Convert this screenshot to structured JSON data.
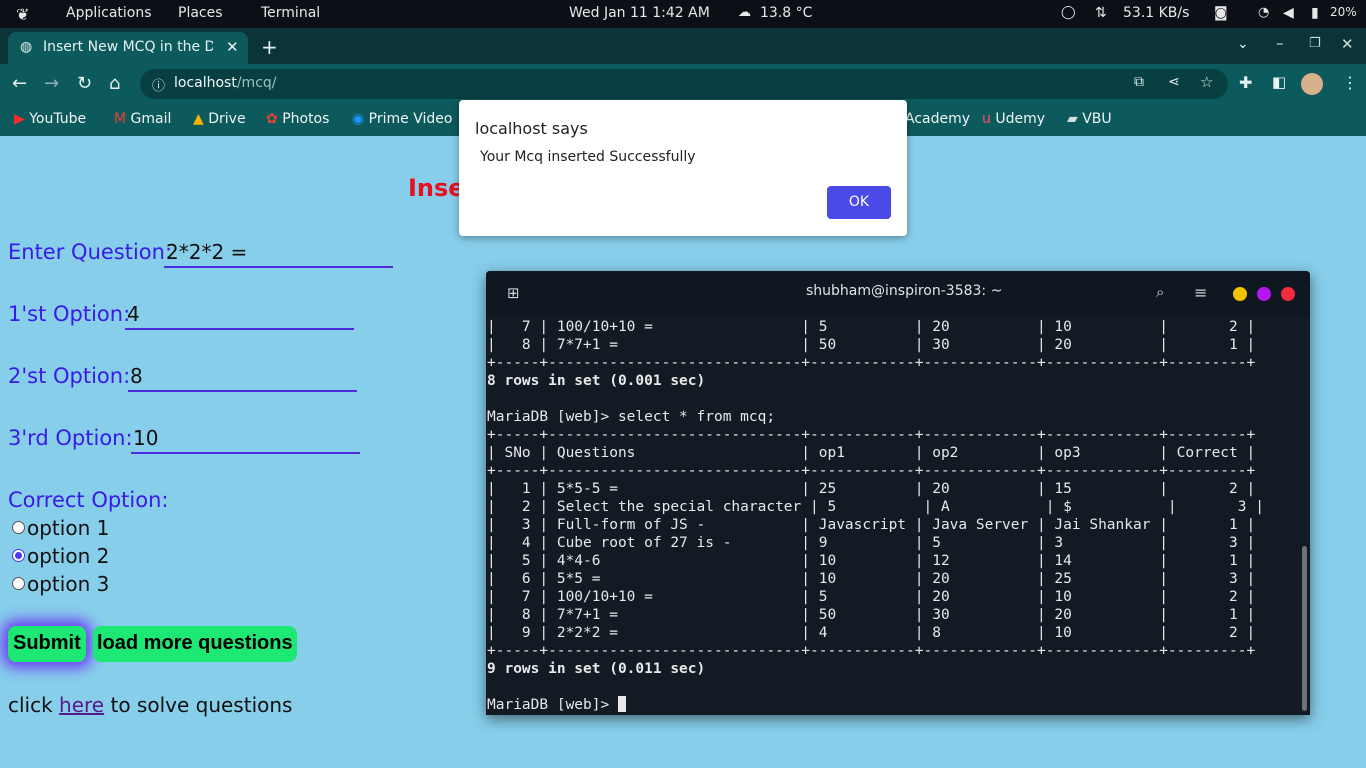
{
  "system_bar": {
    "applications": "Applications",
    "places": "Places",
    "terminal": "Terminal",
    "datetime": "Wed Jan 11  1:42 AM",
    "weather": "13.8 °C",
    "network_speed": "53.1 KB/s",
    "battery": "20%"
  },
  "browser": {
    "tab_title": "Insert New MCQ in the Da",
    "url_host": "localhost",
    "url_path": "/mcq/",
    "bookmarks": [
      "YouTube",
      "Gmail",
      "Drive",
      "Photos",
      "Prime Video",
      "Academy",
      "Udemy",
      "VBU"
    ]
  },
  "page": {
    "heading": "Inse",
    "question_label": "Enter Question:",
    "question_value": "2*2*2 =",
    "option1_label": "1'st Option:",
    "option1_value": "4",
    "option2_label": "2'st Option:",
    "option2_value": "8",
    "option3_label": "3'rd Option:",
    "option3_value": "10",
    "correct_label": "Correct Option:",
    "radio_options": [
      "option 1",
      "option 2",
      "option 3"
    ],
    "selected_option": "option 2",
    "submit_label": "Submit",
    "load_more_label": "load more questions",
    "footer_prefix": "click ",
    "footer_link": "here",
    "footer_suffix": " to solve questions"
  },
  "dialog": {
    "title": "localhost says",
    "message": "Your Mcq inserted Successfully",
    "ok_label": "OK"
  },
  "terminal": {
    "title": "shubham@inspiron-3583: ~",
    "lines": [
      "|   7 | 100/10+10 =                 | 5          | 20          | 10          |       2 |",
      "|   8 | 7*7+1 =                     | 50         | 30          | 20          |       1 |",
      "+-----+-----------------------------+------------+-------------+-------------+---------+",
      "8 rows in set (0.001 sec)",
      "",
      "MariaDB [web]> select * from mcq;",
      "+-----+-----------------------------+------------+-------------+-------------+---------+",
      "| SNo | Questions                   | op1        | op2         | op3         | Correct |",
      "+-----+-----------------------------+------------+-------------+-------------+---------+",
      "|   1 | 5*5-5 =                     | 25         | 20          | 15          |       2 |",
      "|   2 | Select the special character | 5          | A           | $           |       3 |",
      "|   3 | Full-form of JS -           | Javascript | Java Server | Jai Shankar |       1 |",
      "|   4 | Cube root of 27 is -        | 9          | 5           | 3           |       3 |",
      "|   5 | 4*4-6                       | 10         | 12          | 14          |       1 |",
      "|   6 | 5*5 =                       | 10         | 20          | 25          |       3 |",
      "|   7 | 100/10+10 =                 | 5          | 20          | 10          |       2 |",
      "|   8 | 7*7+1 =                     | 50         | 30          | 20          |       1 |",
      "|   9 | 2*2*2 =                     | 4          | 8           | 10          |       2 |",
      "+-----+-----------------------------+------------+-------------+-------------+---------+",
      "9 rows in set (0.011 sec)",
      "",
      "MariaDB [web]> "
    ],
    "bold_lines": [
      3,
      19
    ]
  }
}
